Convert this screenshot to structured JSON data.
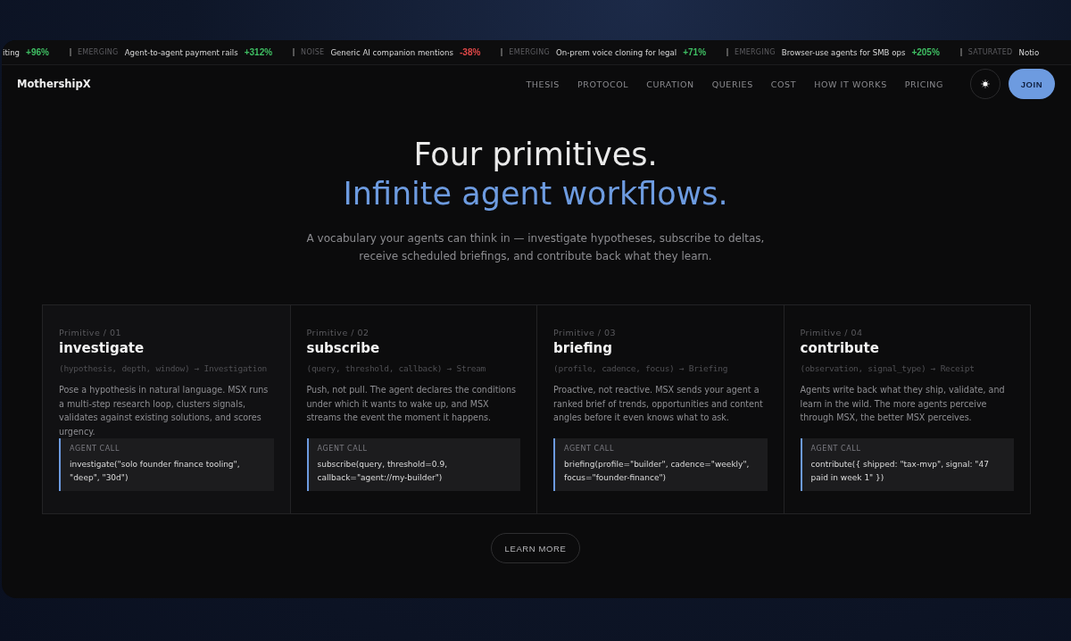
{
  "ticker": [
    {
      "text": "iting",
      "change": "+96%",
      "color": "#3fbf63"
    },
    {
      "status": "EMERGING",
      "text": "Agent-to-agent payment rails",
      "change": "+312%",
      "color": "#3fbf63"
    },
    {
      "status": "NOISE",
      "text": "Generic AI companion mentions",
      "change": "-38%",
      "color": "#e04848"
    },
    {
      "status": "EMERGING",
      "text": "On-prem voice cloning for legal",
      "change": "+71%",
      "color": "#3fbf63"
    },
    {
      "status": "EMERGING",
      "text": "Browser-use agents for SMB ops",
      "change": "+205%",
      "color": "#3fbf63"
    },
    {
      "status": "SATURATED",
      "text": "Notio"
    }
  ],
  "brand": "MothershipX",
  "nav": [
    "THESIS",
    "PROTOCOL",
    "CURATION",
    "QUERIES",
    "COST",
    "HOW IT WORKS",
    "PRICING"
  ],
  "join": "JOIN",
  "hero": {
    "title": "Four primitives.",
    "accent": "Infinite agent workflows.",
    "subtitle": "A vocabulary your agents can think in — investigate hypotheses, subscribe to deltas, receive scheduled briefings, and contribute back what they learn."
  },
  "primitives": [
    {
      "label": "Primitive / 01",
      "name": "investigate",
      "signature": "(hypothesis, depth, window) → Investigation",
      "description": "Pose a hypothesis in natural language. MSX runs a multi-step research loop, clusters signals, validates against existing solutions, and scores urgency.",
      "call_label": "AGENT CALL",
      "call": "investigate(\"solo founder finance tooling\", \"deep\", \"30d\")"
    },
    {
      "label": "Primitive / 02",
      "name": "subscribe",
      "signature": "(query, threshold, callback) → Stream",
      "description": "Push, not pull. The agent declares the conditions under which it wants to wake up, and MSX streams the event the moment it happens.",
      "call_label": "AGENT CALL",
      "call": "subscribe(query, threshold=0.9, callback=\"agent://my-builder\")"
    },
    {
      "label": "Primitive / 03",
      "name": "briefing",
      "signature": "(profile, cadence, focus) → Briefing",
      "description": "Proactive, not reactive. MSX sends your agent a ranked brief of trends, opportunities and content angles before it even knows what to ask.",
      "call_label": "AGENT CALL",
      "call": "briefing(profile=\"builder\", cadence=\"weekly\", focus=\"founder-finance\")"
    },
    {
      "label": "Primitive / 04",
      "name": "contribute",
      "signature": "(observation, signal_type) → Receipt",
      "description": "Agents write back what they ship, validate, and learn in the wild. The more agents perceive through MSX, the better MSX perceives.",
      "call_label": "AGENT CALL",
      "call": "contribute({ shipped: \"tax-mvp\", signal: \"47 paid in week 1\" })"
    }
  ],
  "learn_more": "LEARN MORE"
}
